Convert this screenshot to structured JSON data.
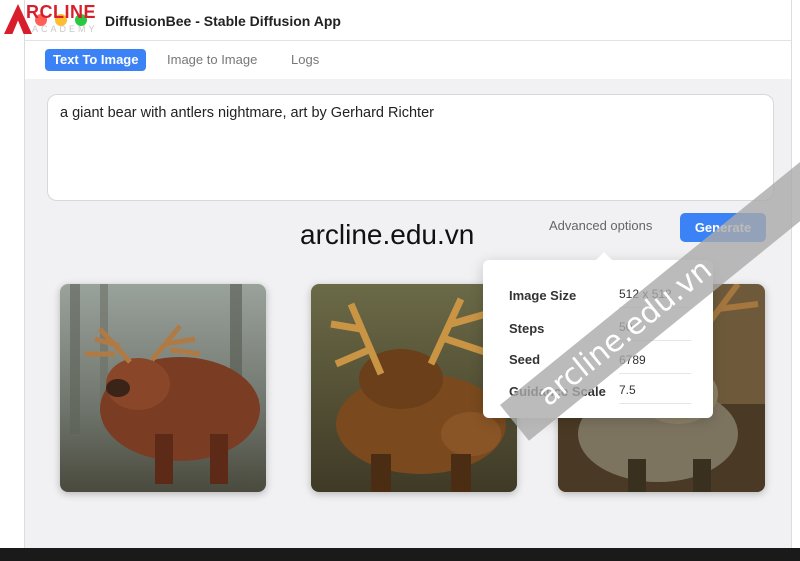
{
  "brand": {
    "name": "RCLINE",
    "subtitle": "ACADEMY"
  },
  "window": {
    "title": "DiffusionBee - Stable Diffusion App"
  },
  "tabs": [
    {
      "label": "Text To Image",
      "active": true
    },
    {
      "label": "Image to Image",
      "active": false
    },
    {
      "label": "Logs",
      "active": false
    }
  ],
  "prompt": {
    "value": "a giant bear with antlers nightmare, art by Gerhard Richter"
  },
  "toolbar": {
    "advanced_label": "Advanced options",
    "generate_label": "Generate"
  },
  "advanced_options": {
    "image_size_label": "Image Size",
    "image_size_value": "512 x 512",
    "steps_label": "Steps",
    "steps_value": "50",
    "seed_label": "Seed",
    "seed_value": "6789",
    "guidance_label": "Guidance Scale",
    "guidance_value": "7.5"
  },
  "watermarks": {
    "center": "arcline.edu.vn",
    "diagonal": "arcline.edu.vn"
  },
  "colors": {
    "accent": "#3b82f6",
    "brand": "#d81e2a"
  }
}
